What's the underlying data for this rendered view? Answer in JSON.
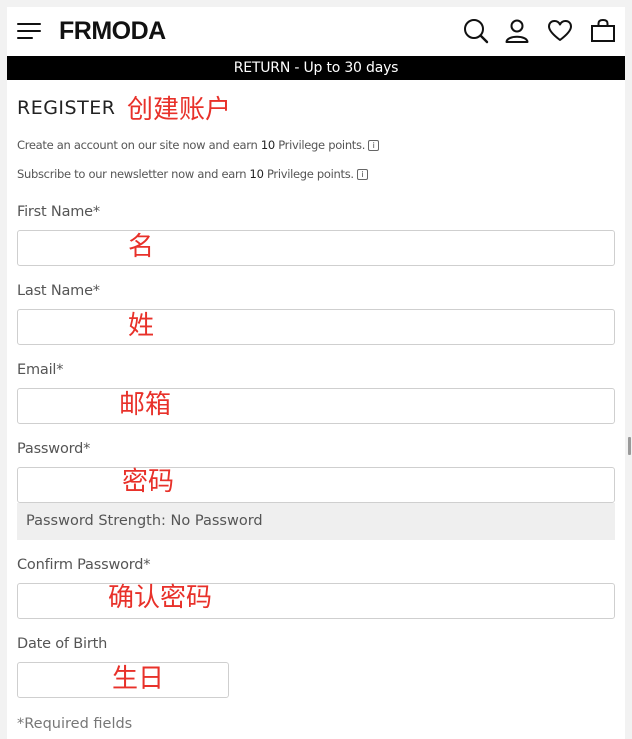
{
  "header": {
    "logo": "FRMODA",
    "icons": [
      "menu-icon",
      "search-icon",
      "account-icon",
      "heart-icon",
      "bag-icon"
    ]
  },
  "promo": {
    "text": "RETURN - Up to 30 days"
  },
  "register": {
    "title": "REGISTER",
    "title_annotation": "创建账户",
    "note1": {
      "before": "Create an account on our site now and earn",
      "points": "10",
      "after": "Privilege points.",
      "icon": "i"
    },
    "note2": {
      "before": "Subscribe to our newsletter now and earn",
      "points": "10",
      "after": "Privilege points.",
      "icon": "i"
    }
  },
  "fields": {
    "first_name": {
      "label": "First Name*",
      "value": "",
      "annotation": "名"
    },
    "last_name": {
      "label": "Last Name*",
      "value": "",
      "annotation": "姓"
    },
    "email": {
      "label": "Email*",
      "value": "",
      "annotation": "邮箱"
    },
    "password": {
      "label": "Password*",
      "value": "",
      "annotation": "密码"
    },
    "password_strength": "Password Strength: No Password",
    "confirm_password": {
      "label": "Confirm Password*",
      "value": "",
      "annotation": "确认密码"
    },
    "dob": {
      "label": "Date of Birth",
      "value": "",
      "annotation": "生日"
    }
  },
  "footer": {
    "required": "*Required fields"
  },
  "colors": {
    "annotation": "#e8312a",
    "promo_bg": "#000000",
    "field_border": "#cfcfcf",
    "strength_bg": "#efefef"
  }
}
